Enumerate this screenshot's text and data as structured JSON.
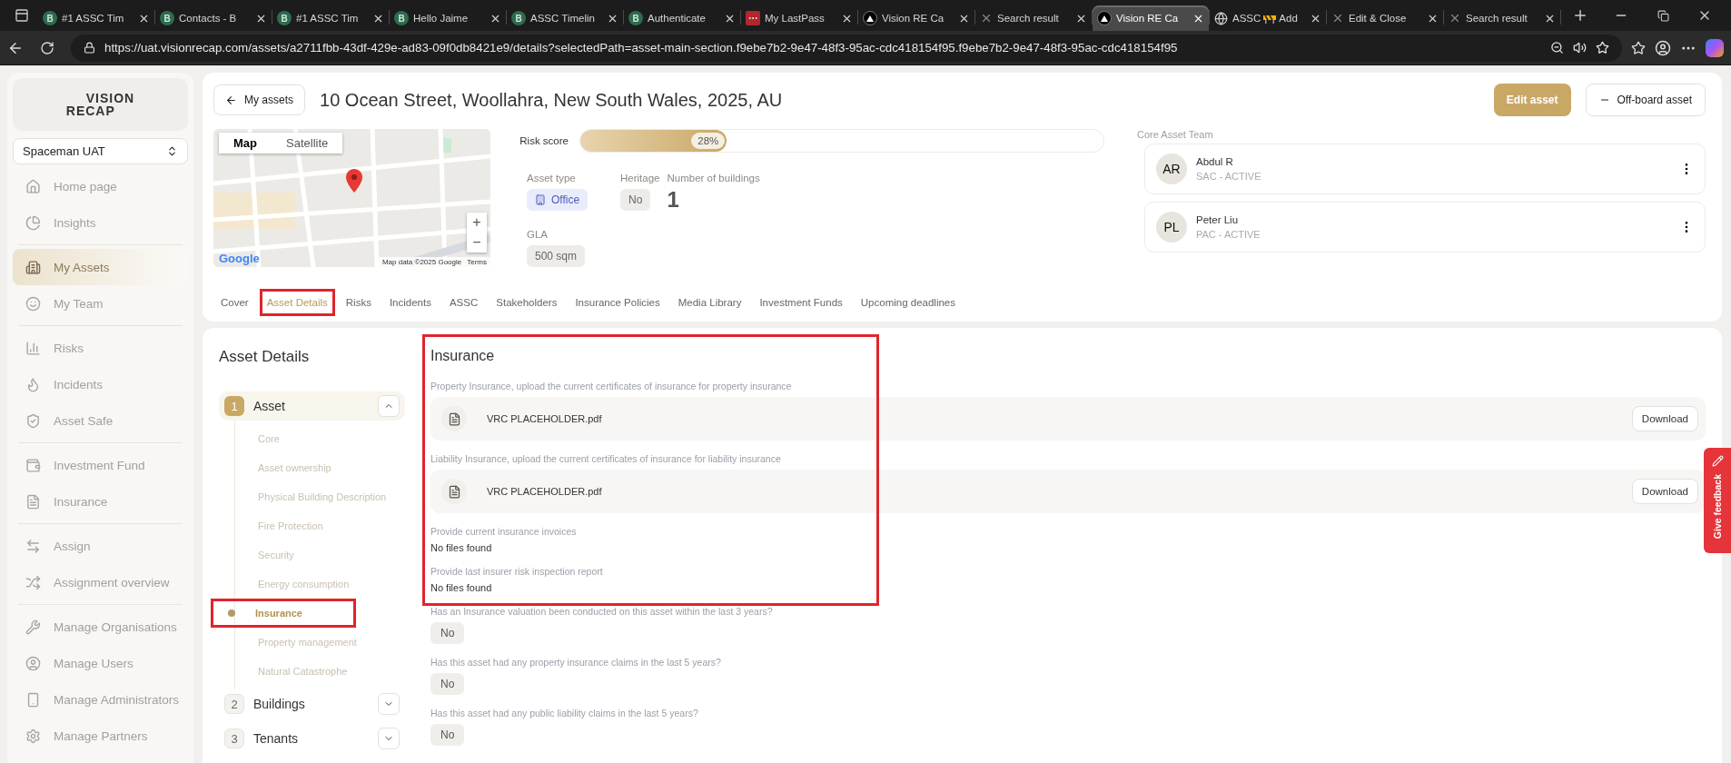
{
  "browser": {
    "tabs": [
      {
        "title": "#1 ASSC Tim",
        "kind": "letter",
        "favicon_letter": "B",
        "selected": false
      },
      {
        "title": "Contacts - B",
        "kind": "letter",
        "favicon_letter": "B",
        "selected": false
      },
      {
        "title": "#1 ASSC Tim",
        "kind": "letter",
        "favicon_letter": "B",
        "selected": false
      },
      {
        "title": "Hello Jaime",
        "kind": "letter",
        "favicon_letter": "B",
        "selected": false
      },
      {
        "title": "ASSC Timelin",
        "kind": "letter",
        "favicon_letter": "B",
        "selected": false
      },
      {
        "title": "Authenticate",
        "kind": "letter",
        "favicon_letter": "B",
        "selected": false
      },
      {
        "title": "My LastPass",
        "kind": "dots",
        "selected": false
      },
      {
        "title": "Vision RE Ca",
        "kind": "triangle",
        "selected": false
      },
      {
        "title": "Search result",
        "kind": "cross",
        "selected": false
      },
      {
        "title": "Vision RE Ca",
        "kind": "triangle",
        "selected": true
      },
      {
        "title": "ASSC",
        "title_after_icon": "Add",
        "kind": "globe",
        "selected": false
      },
      {
        "title": "Edit & Close",
        "kind": "cross",
        "selected": false
      },
      {
        "title": "Search result",
        "kind": "cross",
        "selected": false
      }
    ],
    "url": "https://uat.visionrecap.com/assets/a2711fbb-43df-429e-ad83-09f0db8421e9/details?selectedPath=asset-main-section.f9ebe7b2-9e47-48f3-95ac-cdc418154f95.f9ebe7b2-9e47-48f3-95ac-cdc418154f95"
  },
  "sidebar": {
    "logo": {
      "line_1": "VISION",
      "line_2": "RECAP"
    },
    "organisation": "Spaceman UAT",
    "nav_groups": [
      [
        {
          "label": "Home page",
          "selected": false
        },
        {
          "label": "Insights",
          "selected": false
        }
      ],
      [
        {
          "label": "My Assets",
          "selected": true
        },
        {
          "label": "My Team",
          "selected": false
        }
      ],
      [
        {
          "label": "Risks",
          "selected": false
        },
        {
          "label": "Incidents",
          "selected": false
        },
        {
          "label": "Asset Safe",
          "selected": false
        }
      ],
      [
        {
          "label": "Investment Fund",
          "selected": false
        },
        {
          "label": "Insurance",
          "selected": false
        }
      ],
      [
        {
          "label": "Assign",
          "selected": false
        },
        {
          "label": "Assignment overview",
          "selected": false
        }
      ],
      [
        {
          "label": "Manage Organisations",
          "selected": false
        },
        {
          "label": "Manage Users",
          "selected": false
        },
        {
          "label": "Manage Administrators",
          "selected": false
        },
        {
          "label": "Manage Partners",
          "selected": false
        }
      ]
    ]
  },
  "header": {
    "back_button": "My assets",
    "title": "10 Ocean Street, Woollahra, New South Wales, 2025, AU",
    "buttons": [
      {
        "label": "Edit asset",
        "kind": "primary"
      },
      {
        "label": "Off-board asset",
        "kind": "outline"
      }
    ]
  },
  "map": {
    "view_toggle": [
      {
        "label": "Map",
        "selected": true
      },
      {
        "label": "Satellite",
        "selected": false
      }
    ],
    "zoom_in": "+",
    "zoom_out": "−",
    "logo": "Google",
    "attribution": "Map data ©2025 Google",
    "terms": "Terms"
  },
  "risk_score": {
    "label": "Risk score",
    "level": 0.28,
    "reading": "28%"
  },
  "asset_info": {
    "asset_type": {
      "label": "Asset type",
      "value": "Office"
    },
    "heritage": {
      "label": "Heritage",
      "value": "No"
    },
    "number_of_buildings": {
      "label": "Number of buildings",
      "value": "1"
    },
    "gla": {
      "label": "GLA",
      "value": "500 sqm"
    }
  },
  "core_asset_team": {
    "label": "Core Asset Team",
    "members": [
      {
        "initials": "AR",
        "name": "Abdul R",
        "role": "SAC - ACTIVE"
      },
      {
        "initials": "PL",
        "name": "Peter Liu",
        "role": "PAC - ACTIVE"
      }
    ]
  },
  "tabs": [
    {
      "label": "Cover",
      "selected": false,
      "highlighted": false
    },
    {
      "label": "Asset Details",
      "selected": true,
      "highlighted": true
    },
    {
      "label": "Risks",
      "selected": false,
      "highlighted": false
    },
    {
      "label": "Incidents",
      "selected": false,
      "highlighted": false
    },
    {
      "label": "ASSC",
      "selected": false,
      "highlighted": false
    },
    {
      "label": "Stakeholders",
      "selected": false,
      "highlighted": false
    },
    {
      "label": "Insurance Policies",
      "selected": false,
      "highlighted": false
    },
    {
      "label": "Media Library",
      "selected": false,
      "highlighted": false
    },
    {
      "label": "Investment Funds",
      "selected": false,
      "highlighted": false
    },
    {
      "label": "Upcoming deadlines",
      "selected": false,
      "highlighted": false
    }
  ],
  "asset_details": {
    "title": "Asset Details",
    "steps": [
      {
        "number": "1",
        "label": "Asset",
        "expanded": true,
        "children": [
          {
            "label": "Core",
            "selected": false,
            "highlighted": false
          },
          {
            "label": "Asset ownership",
            "selected": false,
            "highlighted": false
          },
          {
            "label": "Physical Building Description",
            "selected": false,
            "highlighted": false
          },
          {
            "label": "Fire Protection",
            "selected": false,
            "highlighted": false
          },
          {
            "label": "Security",
            "selected": false,
            "highlighted": false
          },
          {
            "label": "Energy consumption",
            "selected": false,
            "highlighted": false
          },
          {
            "label": "Insurance",
            "selected": true,
            "highlighted": true
          },
          {
            "label": "Property management",
            "selected": false,
            "highlighted": false
          },
          {
            "label": "Natural Catastrophe",
            "selected": false,
            "highlighted": false
          }
        ]
      },
      {
        "number": "2",
        "label": "Buildings",
        "expanded": false
      },
      {
        "number": "3",
        "label": "Tenants",
        "expanded": false
      }
    ]
  },
  "insurance": {
    "title": "Insurance",
    "highlighted": true,
    "documents": [
      {
        "label": "Property Insurance, upload the current certificates of insurance for property insurance",
        "files": [
          {
            "name": "VRC PLACEHOLDER.pdf",
            "action": "Download"
          }
        ]
      },
      {
        "label": "Liability Insurance, upload the current certificates of insurance for liability insurance",
        "files": [
          {
            "name": "VRC PLACEHOLDER.pdf",
            "action": "Download"
          }
        ]
      },
      {
        "label": "Provide current insurance invoices",
        "empty_text": "No files found"
      },
      {
        "label": "Provide last insurer risk inspection report",
        "empty_text": "No files found"
      }
    ],
    "questions": [
      {
        "question": "Has an Insurance valuation been conducted on this asset within the last 3 years?",
        "answer": "No"
      },
      {
        "question": "Has this asset had any property insurance claims in the last 5 years?",
        "answer": "No"
      },
      {
        "question": "Has this asset had any public liability claims in the last 5 years?",
        "answer": "No"
      }
    ]
  },
  "feedback_tab": "Give feedback"
}
